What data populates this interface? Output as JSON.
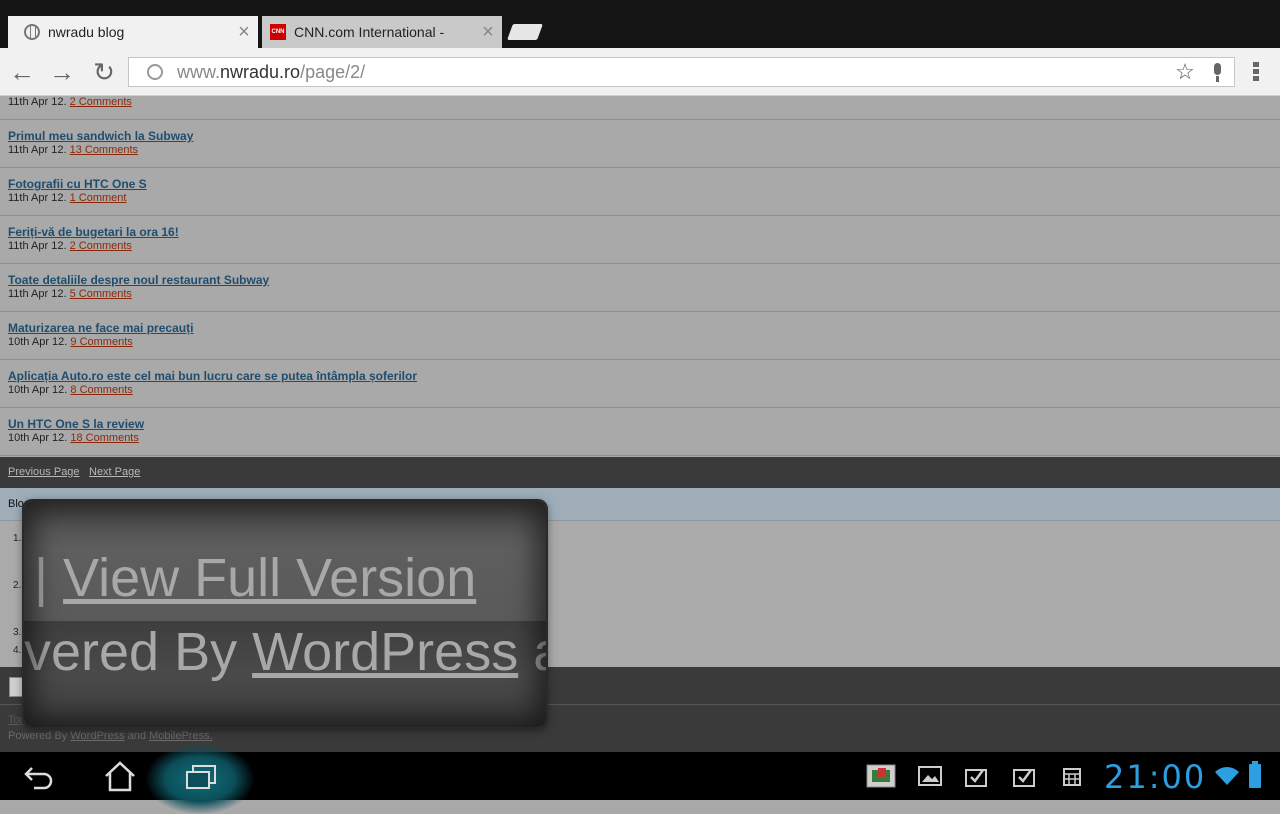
{
  "tabs": [
    {
      "title": "nwradu blog",
      "close": "×"
    },
    {
      "title": "CNN.com International -",
      "close": "×",
      "favicon": "CNN"
    }
  ],
  "toolbar": {
    "url_prefix": "www.",
    "url_domain": "nwradu.ro",
    "url_path": "/page/2/"
  },
  "posts": [
    {
      "title": "",
      "date": "11th Apr 12.",
      "comments": "2 Comments"
    },
    {
      "title": "Primul meu sandwich la Subway",
      "date": "11th Apr 12.",
      "comments": "13 Comments"
    },
    {
      "title": "Fotografii cu HTC One S",
      "date": "11th Apr 12.",
      "comments": "1 Comment"
    },
    {
      "title": "Feriți-vă de bugetari la ora 16!",
      "date": "11th Apr 12.",
      "comments": "2 Comments"
    },
    {
      "title": "Toate detaliile despre noul restaurant Subway",
      "date": "11th Apr 12.",
      "comments": "5 Comments"
    },
    {
      "title": "Maturizarea ne face mai precauți",
      "date": "10th Apr 12.",
      "comments": "9 Comments"
    },
    {
      "title": "Aplicația Auto.ro este cel mai bun lucru care se putea întâmpla șoferilor",
      "date": "10th Apr 12.",
      "comments": "8 Comments"
    },
    {
      "title": "Un HTC One S la review",
      "date": "10th Apr 12.",
      "comments": "18 Comments"
    }
  ],
  "pagination": {
    "prev": "Previous Page",
    "next": "Next Page"
  },
  "blog_section": {
    "label": "Blog"
  },
  "list_numbers": [
    "1.",
    "2.",
    "3.",
    "4."
  ],
  "footer": {
    "top": "Top",
    "powered": "Powered By",
    "wordpress": "WordPress",
    "and": "and",
    "mobilepress": "MobilePress."
  },
  "loupe": {
    "line1_sep": "|",
    "line1_link": "View Full Version",
    "line2_prefix": "vered By",
    "line2_link": "WordPress",
    "line2_suffix": "a"
  },
  "system": {
    "clock": "21:00",
    "accent": "#2b9fe0"
  }
}
